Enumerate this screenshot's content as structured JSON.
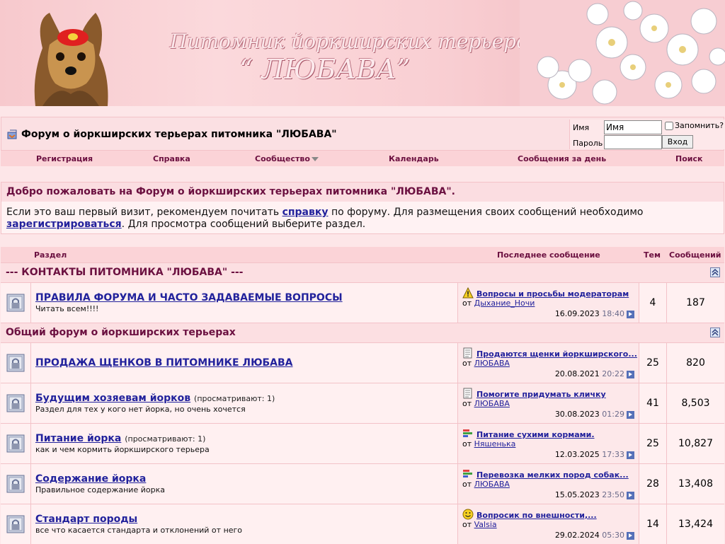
{
  "banner": {
    "title": "Питомник йоркширских терьеров",
    "name": "“ ЛЮБАВА”"
  },
  "navbar": {
    "forum_title": "Форум о йоркширских терьерах питомника \"ЛЮБАВА\"",
    "login": {
      "name_label": "Имя",
      "name_value": "Имя",
      "password_label": "Пароль",
      "remember_label": "Запомнить?",
      "submit_label": "Вход"
    }
  },
  "menu": [
    "Регистрация",
    "Справка",
    "Сообщество",
    "Календарь",
    "Сообщения за день",
    "Поиск"
  ],
  "welcome": {
    "heading": "Добро пожаловать на Форум о йоркширских терьерах питомника \"ЛЮБАВА\".",
    "text_1": "Если это ваш первый визит, рекомендуем почитать ",
    "link_help": "справку",
    "text_2": " по форуму. Для размещения своих сообщений необходимо ",
    "link_register": "зарегистрироваться",
    "text_3": ". Для просмотра сообщений выберите раздел."
  },
  "table": {
    "headers": {
      "section": "Раздел",
      "last_post": "Последнее сообщение",
      "threads": "Тем",
      "posts": "Сообщений"
    },
    "categories": [
      {
        "title": "--- КОНТАКТЫ ПИТОМНИКА \"ЛЮБАВА\" ---",
        "forums": [
          {
            "title": "ПРАВИЛА ФОРУМА И ЧАСТО ЗАДАВАЕМЫЕ ВОПРОСЫ",
            "viewers": "",
            "desc": "Читать всем!!!!",
            "lp_icon": "warning-icon",
            "lp_title": "Вопросы и просьбы модераторам",
            "lp_by_prefix": "от",
            "lp_author": "Дыхание_Ночи",
            "lp_date": "16.09.2023",
            "lp_time": "18:40",
            "threads": "4",
            "posts": "187"
          }
        ]
      },
      {
        "title": "Общий форум о йоркширских терьерах",
        "forums": [
          {
            "title": "ПРОДАЖА ЩЕНКОВ В ПИТОМНИКЕ ЛЮБАВА",
            "viewers": "",
            "desc": "",
            "lp_icon": "document-icon",
            "lp_title": "Продаются щенки йоркширского...",
            "lp_by_prefix": "от",
            "lp_author": "ЛЮБАВА",
            "lp_date": "20.08.2021",
            "lp_time": "20:22",
            "threads": "25",
            "posts": "820"
          },
          {
            "title": "Будущим хозяевам йорков",
            "viewers": "(просматривают: 1)",
            "desc": "Раздел для тех у кого нет йорка, но очень хочется",
            "lp_icon": "document-icon",
            "lp_title": "Помогите придумать кличку",
            "lp_by_prefix": "от",
            "lp_author": "ЛЮБАВА",
            "lp_date": "30.08.2023",
            "lp_time": "01:29",
            "threads": "41",
            "posts": "8,503"
          },
          {
            "title": "Питание йорка",
            "viewers": "(просматривают: 1)",
            "desc": "как и чем кормить йоркширского терьера",
            "lp_icon": "chart-icon",
            "lp_title": "Питание сухими кормами.",
            "lp_by_prefix": "от",
            "lp_author": "Няшенька",
            "lp_date": "12.03.2025",
            "lp_time": "17:33",
            "threads": "25",
            "posts": "10,827"
          },
          {
            "title": "Содержание йорка",
            "viewers": "",
            "desc": "Правильное содержание йорка",
            "lp_icon": "chart-icon",
            "lp_title": "Перевозка мелких пород собак...",
            "lp_by_prefix": "от",
            "lp_author": "ЛЮБАВА",
            "lp_date": "15.05.2023",
            "lp_time": "23:50",
            "threads": "28",
            "posts": "13,408"
          },
          {
            "title": "Стандарт породы",
            "viewers": "",
            "desc": "все что касается стандарта и отклонений от него",
            "lp_icon": "smiley-icon",
            "lp_title": "Вопросик по внешности,...",
            "lp_by_prefix": "от",
            "lp_author": "Valsia",
            "lp_date": "29.02.2024",
            "lp_time": "05:30",
            "threads": "14",
            "posts": "13,424"
          }
        ]
      }
    ]
  }
}
